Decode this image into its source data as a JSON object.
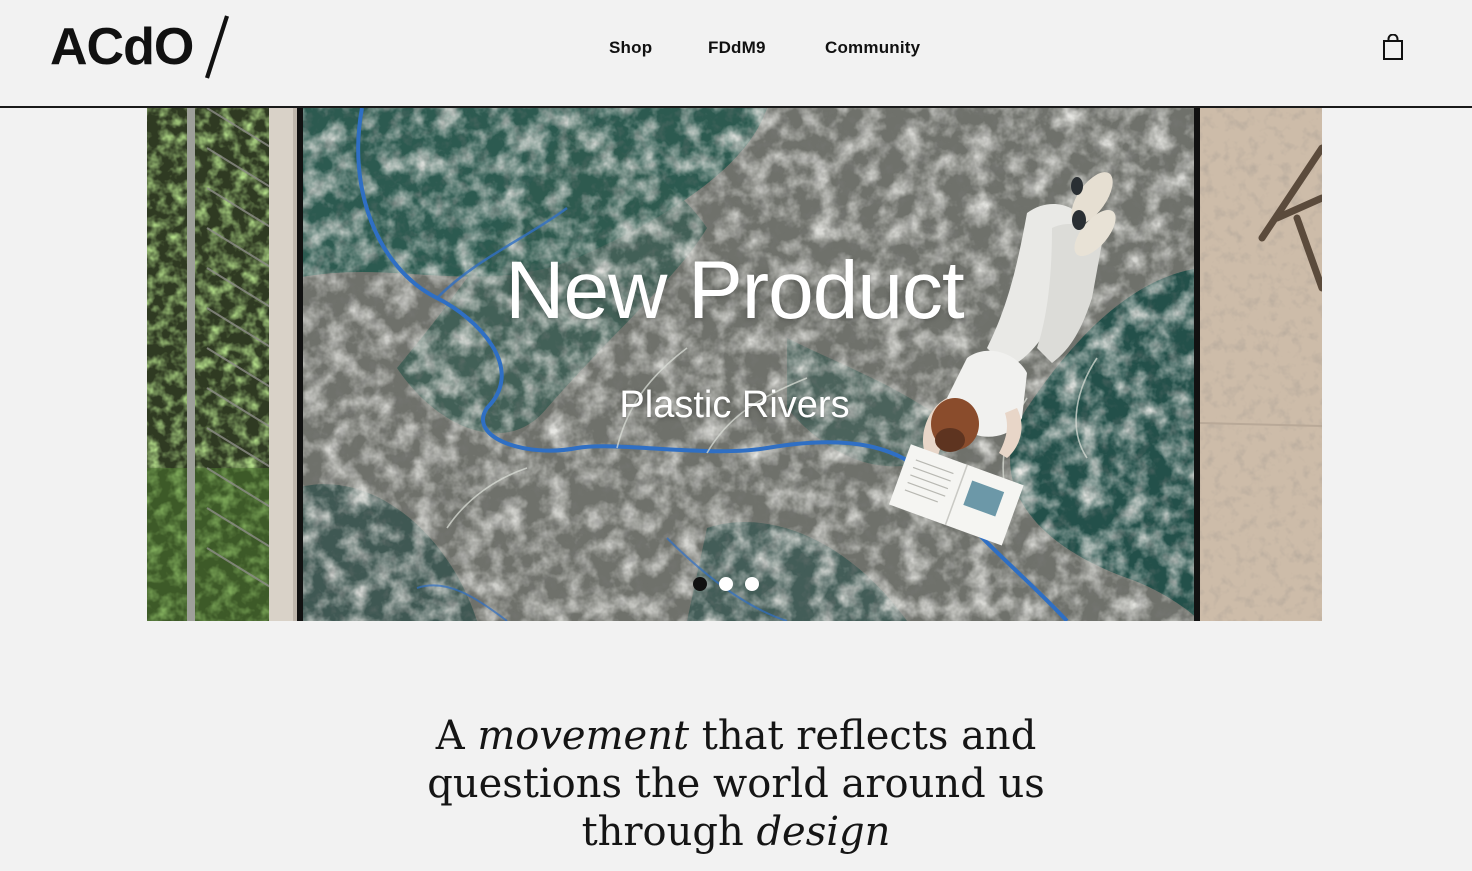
{
  "brand": {
    "logo_text": "ACdO",
    "logo_icon": "slash-glyph"
  },
  "nav": {
    "items": [
      {
        "label": "Shop"
      },
      {
        "label": "FDdM9"
      },
      {
        "label": "Community"
      }
    ],
    "cart_icon": "shopping-bag-icon"
  },
  "hero": {
    "title": "New Product",
    "subtitle": "Plastic Rivers",
    "slides_total": 3,
    "active_slide": 1
  },
  "tagline": {
    "part1": "A ",
    "emphasis1": "movement",
    "part2": " that reflects and questions the world around us through ",
    "emphasis2": "design"
  },
  "colors": {
    "background": "#f2f2f2",
    "text": "#111111",
    "rug_green": "#2f5a4f",
    "river_blue": "#2f6fc4"
  }
}
